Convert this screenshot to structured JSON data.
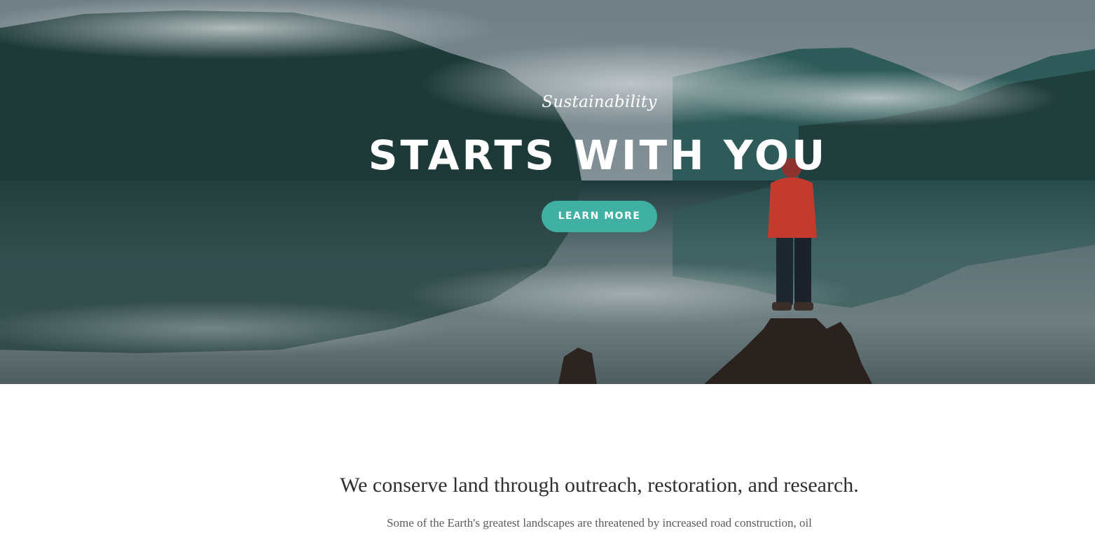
{
  "hero": {
    "eyebrow": "Sustainability",
    "headline": "STARTS WITH YOU",
    "cta_label": "LEARN MORE",
    "image": "misty-lake-landscape-photo"
  },
  "intro": {
    "lead": "We conserve land through outreach, restoration, and research.",
    "body": "Some of the Earth's greatest landscapes are threatened by increased road construction, oil"
  },
  "colors": {
    "accent": "#3fb0a2",
    "heading_text": "#ffffff",
    "lead_text": "#2f2f2f",
    "body_text": "#5b5b5b"
  }
}
